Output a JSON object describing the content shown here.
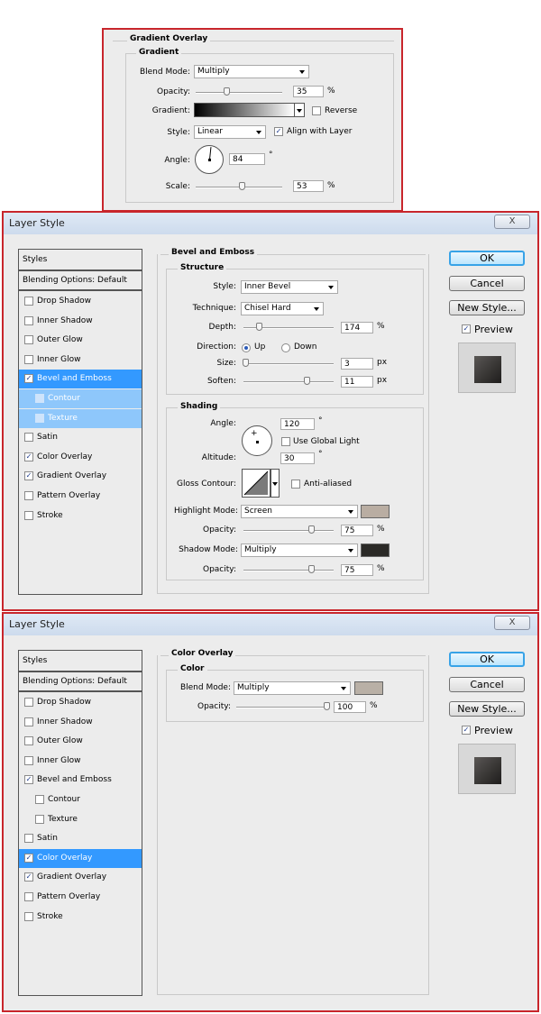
{
  "gradient_panel": {
    "section_title": "Gradient Overlay",
    "group_title": "Gradient",
    "blend_mode_label": "Blend Mode:",
    "blend_mode_value": "Multiply",
    "opacity_label": "Opacity:",
    "opacity_value": "35",
    "opacity_unit": "%",
    "opacity_level": 0.35,
    "gradient_label": "Gradient:",
    "reverse_label": "Reverse",
    "reverse_checked": false,
    "style_label": "Style:",
    "style_value": "Linear",
    "align_label": "Align with Layer",
    "align_checked": true,
    "angle_label": "Angle:",
    "angle_value": "84",
    "angle_unit": "°",
    "scale_label": "Scale:",
    "scale_value": "53",
    "scale_unit": "%",
    "scale_level": 0.53
  },
  "window1": {
    "title": "Layer Style",
    "close_label": "X",
    "styles_header": "Styles",
    "blending_options": "Blending Options: Default",
    "style_items": [
      {
        "label": "Drop Shadow",
        "checked": false
      },
      {
        "label": "Inner Shadow",
        "checked": false
      },
      {
        "label": "Outer Glow",
        "checked": false
      },
      {
        "label": "Inner Glow",
        "checked": false
      },
      {
        "label": "Bevel and Emboss",
        "checked": true
      },
      {
        "label": "Contour",
        "checked": false
      },
      {
        "label": "Texture",
        "checked": false
      },
      {
        "label": "Satin",
        "checked": false
      },
      {
        "label": "Color Overlay",
        "checked": true
      },
      {
        "label": "Gradient Overlay",
        "checked": true
      },
      {
        "label": "Pattern Overlay",
        "checked": false
      },
      {
        "label": "Stroke",
        "checked": false
      }
    ],
    "selected_item": "Bevel and Emboss",
    "buttons": {
      "ok": "OK",
      "cancel": "Cancel",
      "new_style": "New Style...",
      "preview": "Preview"
    },
    "preview_checked": true,
    "bevel": {
      "section_title": "Bevel and Emboss",
      "structure_title": "Structure",
      "style_label": "Style:",
      "style_value": "Inner Bevel",
      "technique_label": "Technique:",
      "technique_value": "Chisel Hard",
      "depth_label": "Depth:",
      "depth_value": "174",
      "depth_unit": "%",
      "depth_level": 0.17,
      "direction_label": "Direction:",
      "direction_up": "Up",
      "direction_down": "Down",
      "size_label": "Size:",
      "size_value": "3",
      "size_unit": "px",
      "size_level": 0.02,
      "soften_label": "Soften:",
      "soften_value": "11",
      "soften_unit": "px",
      "soften_level": 0.7
    },
    "shading": {
      "title": "Shading",
      "angle_label": "Angle:",
      "angle_value": "120",
      "angle_unit": "°",
      "global_light_label": "Use Global Light",
      "global_light_checked": false,
      "altitude_label": "Altitude:",
      "altitude_value": "30",
      "altitude_unit": "°",
      "gloss_label": "Gloss Contour:",
      "anti_aliased_label": "Anti-aliased",
      "highlight_mode_label": "Highlight Mode:",
      "highlight_mode_value": "Screen",
      "highlight_color": "#b9ada2",
      "highlight_opacity_label": "Opacity:",
      "highlight_opacity_value": "75",
      "highlight_opacity_unit": "%",
      "highlight_opacity_level": 0.75,
      "shadow_mode_label": "Shadow Mode:",
      "shadow_mode_value": "Multiply",
      "shadow_color": "#2b2a27",
      "shadow_opacity_label": "Opacity:",
      "shadow_opacity_value": "75",
      "shadow_opacity_unit": "%",
      "shadow_opacity_level": 0.75
    }
  },
  "window2": {
    "title": "Layer Style",
    "close_label": "X",
    "styles_header": "Styles",
    "blending_options": "Blending Options: Default",
    "style_items": [
      {
        "label": "Drop Shadow",
        "checked": false
      },
      {
        "label": "Inner Shadow",
        "checked": false
      },
      {
        "label": "Outer Glow",
        "checked": false
      },
      {
        "label": "Inner Glow",
        "checked": false
      },
      {
        "label": "Bevel and Emboss",
        "checked": true
      },
      {
        "label": "Contour",
        "checked": false
      },
      {
        "label": "Texture",
        "checked": false
      },
      {
        "label": "Satin",
        "checked": false
      },
      {
        "label": "Color Overlay",
        "checked": true
      },
      {
        "label": "Gradient Overlay",
        "checked": true
      },
      {
        "label": "Pattern Overlay",
        "checked": false
      },
      {
        "label": "Stroke",
        "checked": false
      }
    ],
    "selected_item": "Color Overlay",
    "buttons": {
      "ok": "OK",
      "cancel": "Cancel",
      "new_style": "New Style...",
      "preview": "Preview"
    },
    "preview_checked": true,
    "color_overlay": {
      "section_title": "Color Overlay",
      "group_title": "Color",
      "blend_mode_label": "Blend Mode:",
      "blend_mode_value": "Multiply",
      "color": "#b9b0a6",
      "opacity_label": "Opacity:",
      "opacity_value": "100",
      "opacity_unit": "%",
      "opacity_level": 1.0
    }
  }
}
